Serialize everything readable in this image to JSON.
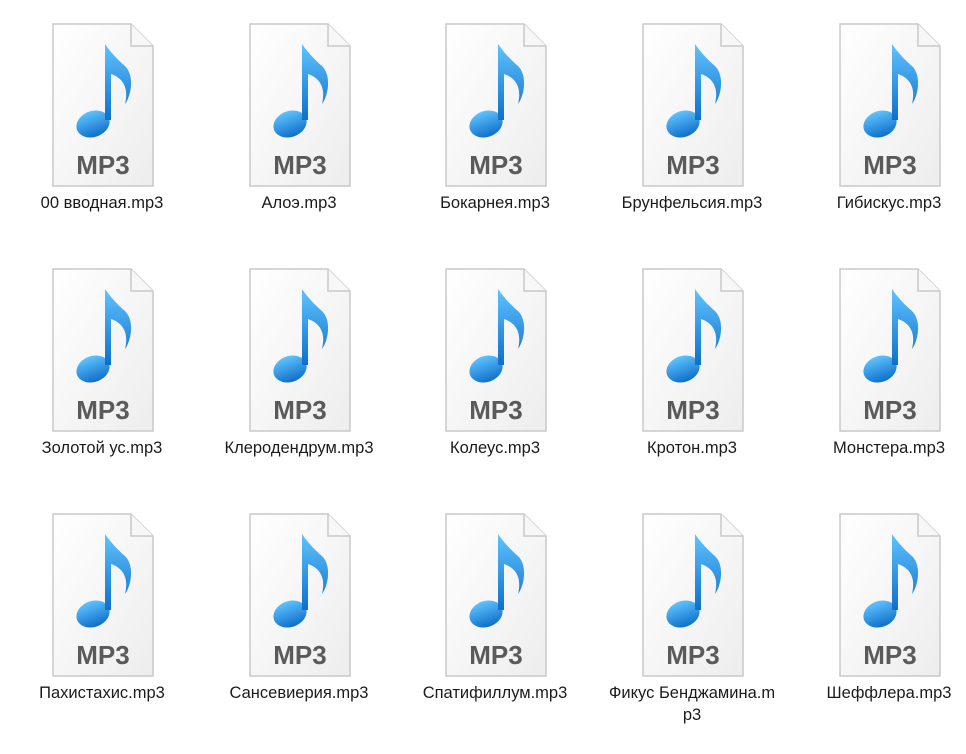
{
  "icon": {
    "name": "mp3-file-icon",
    "badge_text": "MP3",
    "note_color": "#1f8fe3",
    "badge_color": "#5a5a5a"
  },
  "files": [
    {
      "name": "00 вводная.mp3"
    },
    {
      "name": "Алоэ.mp3"
    },
    {
      "name": "Бокарнея.mp3"
    },
    {
      "name": "Брунфельсия.mp3"
    },
    {
      "name": "Гибискус.mp3"
    },
    {
      "name": "Золотой ус.mp3"
    },
    {
      "name": "Клеродендрум.mp3"
    },
    {
      "name": "Колеус.mp3"
    },
    {
      "name": "Кротон.mp3"
    },
    {
      "name": "Монстера.mp3"
    },
    {
      "name": "Пахистахис.mp3"
    },
    {
      "name": "Сансевиерия.mp3"
    },
    {
      "name": "Спатифиллум.mp3"
    },
    {
      "name": "Фикус Бенджамина.mp3"
    },
    {
      "name": "Шеффлера.mp3"
    }
  ]
}
